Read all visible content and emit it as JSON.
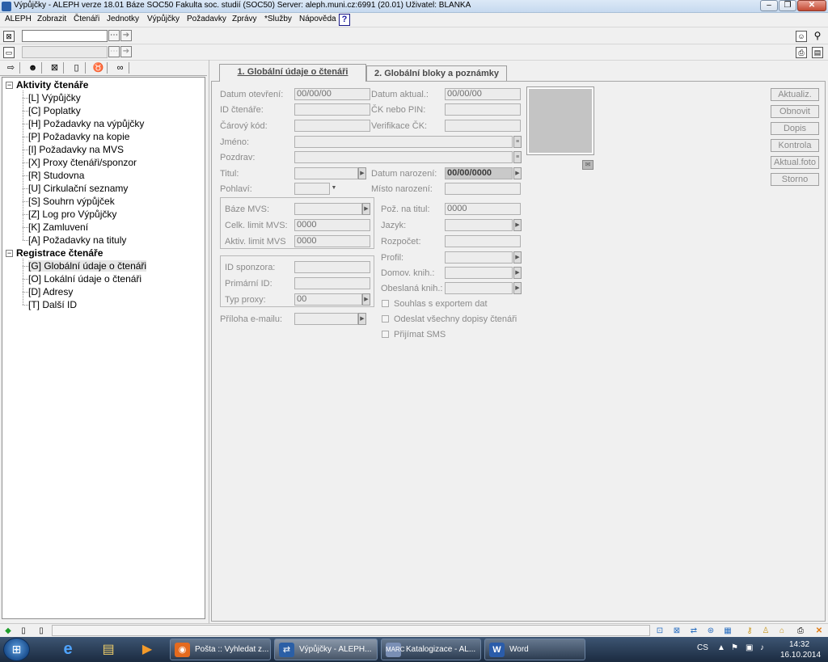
{
  "window": {
    "title": "Výpůjčky - ALEPH verze 18.01  Báze SOC50 Fakulta soc. studií (SOC50)  Server: aleph.muni.cz:6991 (20.01)  Uživatel: BLANKA",
    "minimize": "‒",
    "restore": "❐",
    "close": "✕"
  },
  "menu": {
    "items": [
      "ALEPH",
      "Zobrazit",
      "Čtenáři",
      "Jednotky",
      "Výpůjčky",
      "Požadavky",
      "Zprávy",
      "*Služby",
      "Nápověda"
    ],
    "help": "?"
  },
  "toolbar1": {
    "input_value": "",
    "browse": "⋯",
    "go": "➔"
  },
  "toolbar2": {
    "input_value": "",
    "browse": "⋯",
    "go": "➔"
  },
  "tree": {
    "groups": [
      {
        "label": "Aktivity čtenáře",
        "items": [
          "[L] Výpůjčky",
          "[C] Poplatky",
          "[H] Požadavky na výpůjčky",
          "[P] Požadavky na kopie",
          "[I] Požadavky na MVS",
          "[X] Proxy čtenáři/sponzor",
          "[R] Studovna",
          "[U] Cirkulační seznamy",
          "[S] Souhrn výpůjček",
          "[Z] Log pro Výpůjčky",
          "[K] Zamluvení",
          "[A] Požadavky na tituly"
        ]
      },
      {
        "label": "Registrace čtenáře",
        "items": [
          "[G] Globální údaje o čtenáři",
          "[O] Lokální údaje o čtenáři",
          "[D] Adresy",
          "[T] Další ID"
        ]
      }
    ],
    "expander": "−"
  },
  "tabs": [
    "1. Globální údaje o čtenáři",
    "2. Globální bloky a poznámky"
  ],
  "form": {
    "datum_otevreni": {
      "label": "Datum otevření:",
      "value": "00/00/00"
    },
    "datum_aktual": {
      "label": "Datum aktual.:",
      "value": "00/00/00"
    },
    "id_ctenare": {
      "label": "ID čtenáře:",
      "value": ""
    },
    "ck_pin": {
      "label": "ČK nebo PIN:",
      "value": ""
    },
    "carovy_kod": {
      "label": "Čárový kód:",
      "value": ""
    },
    "verifikace_ck": {
      "label": "Verifikace ČK:",
      "value": ""
    },
    "jmeno": {
      "label": "Jméno:",
      "value": ""
    },
    "pozdrav": {
      "label": "Pozdrav:",
      "value": ""
    },
    "titul": {
      "label": "Titul:",
      "value": ""
    },
    "datum_narozeni": {
      "label": "Datum narození:",
      "value": "00/00/0000"
    },
    "pohlavi": {
      "label": "Pohlaví:",
      "value": ""
    },
    "misto_narozeni": {
      "label": "Místo narození:",
      "value": ""
    },
    "baze_mvs": {
      "label": "Báze MVS:",
      "value": ""
    },
    "celk_limit_mvs": {
      "label": "Celk. limit MVS:",
      "value": "0000"
    },
    "aktiv_limit_mvs": {
      "label": "Aktiv. limit MVS",
      "value": "0000"
    },
    "poz_na_titul": {
      "label": "Pož. na titul:",
      "value": "0000"
    },
    "jazyk": {
      "label": "Jazyk:",
      "value": ""
    },
    "rozpocet": {
      "label": "Rozpočet:",
      "value": ""
    },
    "id_sponzora": {
      "label": "ID sponzora:",
      "value": ""
    },
    "primarni_id": {
      "label": "Primární ID:",
      "value": ""
    },
    "typ_proxy": {
      "label": "Typ proxy:",
      "value": "00"
    },
    "profil": {
      "label": "Profil:",
      "value": ""
    },
    "domov_knih": {
      "label": "Domov. knih.:",
      "value": ""
    },
    "obeslana_knih": {
      "label": "Obeslaná knih.:",
      "value": ""
    },
    "priloha_emailu": {
      "label": "Příloha e-mailu:",
      "value": ""
    },
    "souhlas_export": {
      "label": "Souhlas s exportem dat",
      "checked": false
    },
    "odeslat_dopisy": {
      "label": "Odeslat všechny dopisy čtenáři",
      "checked": false
    },
    "prijimat_sms": {
      "label": "Přijímat SMS",
      "checked": false
    },
    "dropdown_arrow": "▶",
    "combo_arrow": "▼",
    "scroll_icon": "≡",
    "photo_icon": "✉"
  },
  "side_buttons": [
    "Aktualiz.",
    "Obnovit",
    "Dopis",
    "Kontrola",
    "Aktual.foto",
    "Storno"
  ],
  "taskbar": {
    "tasks": [
      "Pošta :: Vyhledat z...",
      "Výpůjčky - ALEPH...",
      "Katalogizace - AL...",
      "Word"
    ],
    "lang": "CS",
    "time": "14:32",
    "date": "16.10.2014"
  }
}
